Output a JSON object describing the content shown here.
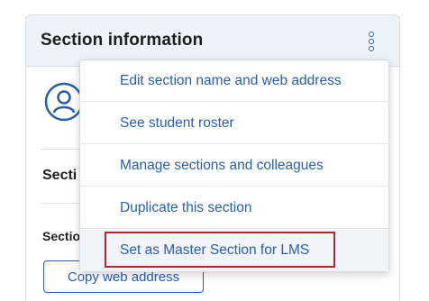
{
  "card": {
    "title": "Section information",
    "menu_icon": "kebab-vertical-icon",
    "section_label": "Secti",
    "section_sub_label": "Sectio",
    "copy_button_label": "Copy web address",
    "avatar_icon": "user-avatar-icon"
  },
  "menu": {
    "items": [
      {
        "label": "Edit section name and web address"
      },
      {
        "label": "See student roster"
      },
      {
        "label": "Manage sections and colleagues"
      },
      {
        "label": "Duplicate this section"
      },
      {
        "label": "Set as Master Section for LMS",
        "highlighted": true
      }
    ]
  },
  "colors": {
    "link_blue": "#2a5fa8",
    "header_bg": "#edf3fa",
    "highlight_border": "#b3262b"
  }
}
